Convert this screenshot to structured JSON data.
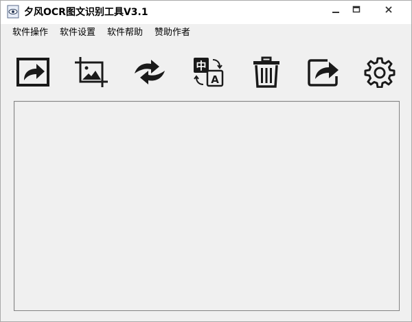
{
  "window": {
    "title": "夕风OCR图文识别工具V3.1",
    "app_icon": "eye-icon"
  },
  "title_buttons": {
    "minimize": "minimize-icon",
    "maximize": "maximize-icon",
    "close": "close-icon"
  },
  "menu": {
    "items": [
      {
        "label": "软件操作"
      },
      {
        "label": "软件设置"
      },
      {
        "label": "软件帮助"
      },
      {
        "label": "赞助作者"
      }
    ]
  },
  "toolbar": {
    "tools": [
      {
        "icon": "import-image-icon"
      },
      {
        "icon": "screenshot-crop-icon"
      },
      {
        "icon": "rotate-icon"
      },
      {
        "icon": "translate-icon"
      },
      {
        "icon": "trash-icon"
      },
      {
        "icon": "share-export-icon"
      },
      {
        "icon": "gear-icon"
      }
    ]
  },
  "main": {
    "result_text": ""
  },
  "colors": {
    "window_bg": "#f0f0f0",
    "titlebar_bg": "#ffffff",
    "icon_color": "#1a1a1a",
    "border": "#828282"
  }
}
